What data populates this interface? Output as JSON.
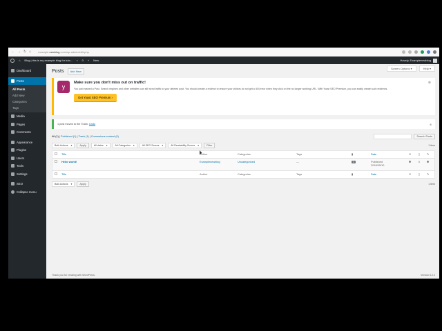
{
  "browser": {
    "url_prefix": "example.",
    "url_domain": "newblog",
    "url_suffix": ".com/wp-admin/edit.php"
  },
  "adminbar": {
    "site_name": "Blog | this is my example blog for tuto...",
    "comments_count": "0",
    "new_label": "New",
    "greeting": "Howdy, Examplenewblog"
  },
  "sidebar": {
    "dashboard": "Dashboard",
    "posts": "Posts",
    "sub": [
      "All Posts",
      "Add New",
      "Categories",
      "Tags"
    ],
    "media": "Media",
    "pages": "Pages",
    "comments": "Comments",
    "appearance": "Appearance",
    "plugins": "Plugins",
    "users": "Users",
    "tools": "Tools",
    "settings": "Settings",
    "seo": "SEO",
    "collapse": "Collapse menu"
  },
  "main": {
    "screen_options": "Screen Options ▾",
    "help": "Help ▾",
    "title": "Posts",
    "add_new": "Add New"
  },
  "yoast_notice": {
    "title": "Make sure you don't miss out on traffic!",
    "text": "You just trashed a Post. Search engines and other websites can still send traffic to your deleted post. You should create a redirect to ensure your visitors do not get a 404 error when they click on the no longer working URL. With Yoast SEO Premium, you can easily create such redirects.",
    "button": "Get Yoast SEO Premium ›"
  },
  "trash_notice": {
    "text": "1 post moved to the Trash.",
    "undo": "Undo"
  },
  "subsubsub": {
    "all": "All (1)",
    "published": "Published (1)",
    "trash": "Trash (1)",
    "cornerstone": "Cornerstone content (0)"
  },
  "search_button": "Search Posts",
  "tablenav": {
    "bulk": "Bulk Actions",
    "apply": "Apply",
    "dates": "All dates",
    "categories": "All Categories",
    "seo": "All SEO Scores",
    "readability": "All Readability Scores",
    "filter": "Filter",
    "items": "1 item"
  },
  "table": {
    "headers": [
      "Title",
      "Author",
      "Categories",
      "Tags",
      "Date"
    ],
    "rows": [
      {
        "title": "Hello world!",
        "author": "Examplenewblog",
        "categories": "Uncategorized",
        "tags": "—",
        "comments": "1",
        "date_status": "Published",
        "date": "2018/05/10"
      }
    ]
  },
  "footer": {
    "thanks": "Thank you for creating with WordPress.",
    "version": "Version 5.2.2"
  }
}
